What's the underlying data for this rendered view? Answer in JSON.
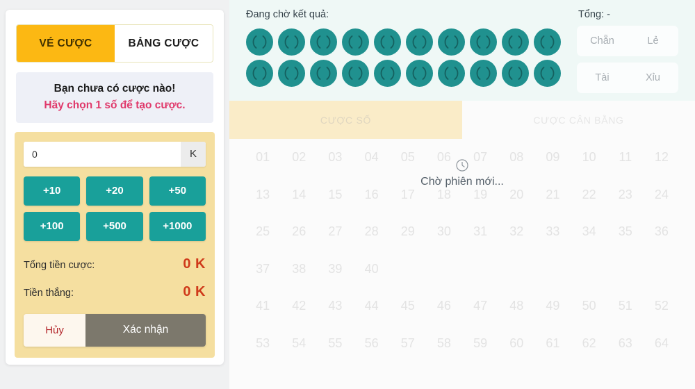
{
  "left_panel": {
    "tabs": [
      {
        "label": "VÉ CƯỢC",
        "active": true
      },
      {
        "label": "BẢNG CƯỢC",
        "active": false
      }
    ],
    "notice": {
      "line1": "Bạn chưa có cược nào!",
      "line2": "Hãy chọn 1 số để tạo cược."
    },
    "amount_input": {
      "value": "0",
      "placeholder": "0",
      "unit": "K"
    },
    "quick_amounts": [
      "+10",
      "+20",
      "+50",
      "+100",
      "+500",
      "+1000"
    ],
    "totals": [
      {
        "label": "Tổng tiền cược:",
        "value": "0 K"
      },
      {
        "label": "Tiền thắng:",
        "value": "0 K"
      }
    ],
    "actions": {
      "cancel": "Hủy",
      "confirm": "Xác nhận"
    }
  },
  "right_panel": {
    "result_title": "Đang chờ kết quả:",
    "balls_count": 20,
    "total_label": "Tổng: -",
    "odd_even": [
      "Chẵn",
      "Lẻ"
    ],
    "high_low": [
      "Tài",
      "Xỉu"
    ],
    "bet_tabs": [
      {
        "label": "CƯỢC SỐ",
        "active": true
      },
      {
        "label": "CƯỢC CÂN BẰNG",
        "active": false
      }
    ],
    "numbers": [
      "01",
      "02",
      "03",
      "04",
      "05",
      "06",
      "07",
      "08",
      "09",
      "10",
      "11",
      "12",
      "13",
      "14",
      "15",
      "16",
      "17",
      "18",
      "19",
      "20",
      "21",
      "22",
      "23",
      "24",
      "25",
      "26",
      "27",
      "28",
      "29",
      "30",
      "31",
      "32",
      "33",
      "34",
      "35",
      "36",
      "37",
      "38",
      "39",
      "40",
      "",
      "",
      "",
      "",
      "",
      "",
      "",
      "",
      "41",
      "42",
      "43",
      "44",
      "45",
      "46",
      "47",
      "48",
      "49",
      "50",
      "51",
      "52",
      "53",
      "54",
      "55",
      "56",
      "57",
      "58",
      "59",
      "60",
      "61",
      "62",
      "63",
      "64"
    ],
    "waiting": {
      "icon": "clock-icon",
      "text": "Chờ phiên mới..."
    }
  },
  "colors": {
    "gold": "#fcb813",
    "teal": "#19a09a",
    "ball_teal": "#20918f",
    "red_value": "#cf3a1a",
    "pink_notice": "#e0396b",
    "confirm_gray": "#7c786c",
    "bet_box_bg": "#f5dfa0"
  }
}
